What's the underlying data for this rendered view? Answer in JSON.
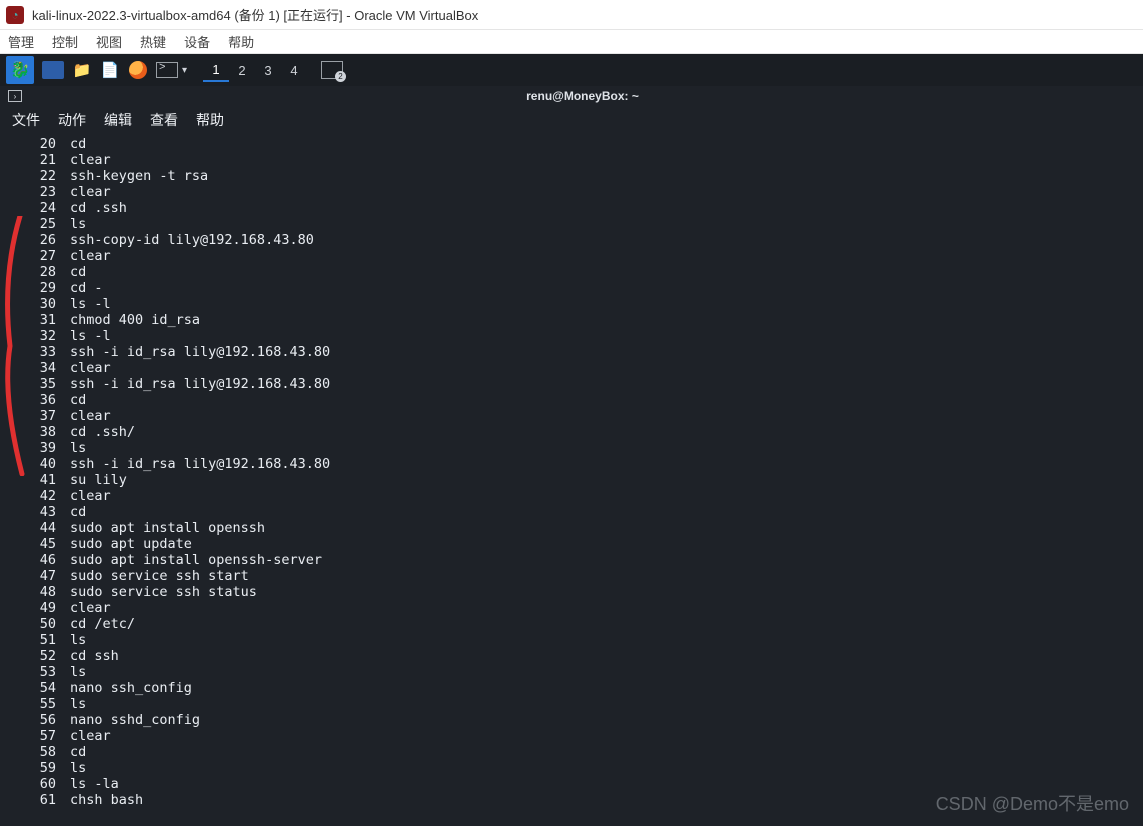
{
  "vbox": {
    "title": "kali-linux-2022.3-virtualbox-amd64 (备份 1) [正在运行] - Oracle VM VirtualBox",
    "menu": [
      "管理",
      "控制",
      "视图",
      "热键",
      "设备",
      "帮助"
    ]
  },
  "kali_panel": {
    "workspaces": [
      "1",
      "2",
      "3",
      "4"
    ],
    "active_workspace": 0,
    "rec_badge": "2"
  },
  "terminal": {
    "title": "renu@MoneyBox: ~",
    "menu": [
      "文件",
      "动作",
      "编辑",
      "查看",
      "帮助"
    ],
    "history": [
      {
        "n": 20,
        "cmd": "cd"
      },
      {
        "n": 21,
        "cmd": "clear"
      },
      {
        "n": 22,
        "cmd": "ssh-keygen -t rsa"
      },
      {
        "n": 23,
        "cmd": "clear"
      },
      {
        "n": 24,
        "cmd": "cd .ssh"
      },
      {
        "n": 25,
        "cmd": "ls"
      },
      {
        "n": 26,
        "cmd": "ssh-copy-id lily@192.168.43.80"
      },
      {
        "n": 27,
        "cmd": "clear"
      },
      {
        "n": 28,
        "cmd": "cd"
      },
      {
        "n": 29,
        "cmd": "cd -"
      },
      {
        "n": 30,
        "cmd": "ls -l"
      },
      {
        "n": 31,
        "cmd": "chmod 400 id_rsa"
      },
      {
        "n": 32,
        "cmd": "ls -l"
      },
      {
        "n": 33,
        "cmd": "ssh -i id_rsa lily@192.168.43.80"
      },
      {
        "n": 34,
        "cmd": "clear"
      },
      {
        "n": 35,
        "cmd": "ssh -i id_rsa lily@192.168.43.80"
      },
      {
        "n": 36,
        "cmd": "cd"
      },
      {
        "n": 37,
        "cmd": "clear"
      },
      {
        "n": 38,
        "cmd": "cd .ssh/"
      },
      {
        "n": 39,
        "cmd": "ls"
      },
      {
        "n": 40,
        "cmd": "ssh -i id_rsa lily@192.168.43.80"
      },
      {
        "n": 41,
        "cmd": "su lily"
      },
      {
        "n": 42,
        "cmd": "clear"
      },
      {
        "n": 43,
        "cmd": "cd"
      },
      {
        "n": 44,
        "cmd": "sudo apt install openssh"
      },
      {
        "n": 45,
        "cmd": "sudo apt update"
      },
      {
        "n": 46,
        "cmd": "sudo apt install openssh-server"
      },
      {
        "n": 47,
        "cmd": "sudo service ssh start"
      },
      {
        "n": 48,
        "cmd": "sudo service ssh status"
      },
      {
        "n": 49,
        "cmd": "clear"
      },
      {
        "n": 50,
        "cmd": "cd /etc/"
      },
      {
        "n": 51,
        "cmd": "ls"
      },
      {
        "n": 52,
        "cmd": "cd ssh"
      },
      {
        "n": 53,
        "cmd": "ls"
      },
      {
        "n": 54,
        "cmd": "nano ssh_config"
      },
      {
        "n": 55,
        "cmd": "ls"
      },
      {
        "n": 56,
        "cmd": "nano sshd_config"
      },
      {
        "n": 57,
        "cmd": "clear"
      },
      {
        "n": 58,
        "cmd": "cd"
      },
      {
        "n": 59,
        "cmd": "ls"
      },
      {
        "n": 60,
        "cmd": "ls -la"
      },
      {
        "n": 61,
        "cmd": "chsh bash"
      }
    ]
  },
  "watermark": "CSDN @Demo不是emo"
}
